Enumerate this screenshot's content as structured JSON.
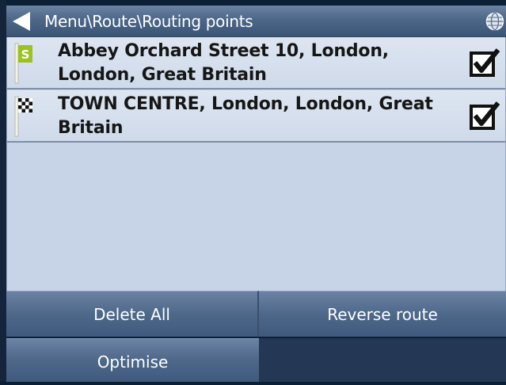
{
  "header": {
    "title": "Menu\\Route\\Routing points",
    "back_icon": "back-arrow-icon",
    "globe_icon": "globe-icon"
  },
  "routing_points": [
    {
      "label": "Abbey Orchard Street 10, London, London, Great Britain",
      "icon": "start-flag-icon",
      "icon_letter": "S",
      "checked": true
    },
    {
      "label": "TOWN CENTRE, London, London, Great Britain",
      "icon": "finish-flag-icon",
      "checked": true
    }
  ],
  "buttons": {
    "delete_all": "Delete All",
    "reverse_route": "Reverse route",
    "optimise": "Optimise"
  },
  "colors": {
    "header": "#4d6789",
    "list_background": "#c7d3e6",
    "row_background": "#d8e1ef",
    "button": "#4e688a",
    "start_flag": "#9bc21f"
  }
}
